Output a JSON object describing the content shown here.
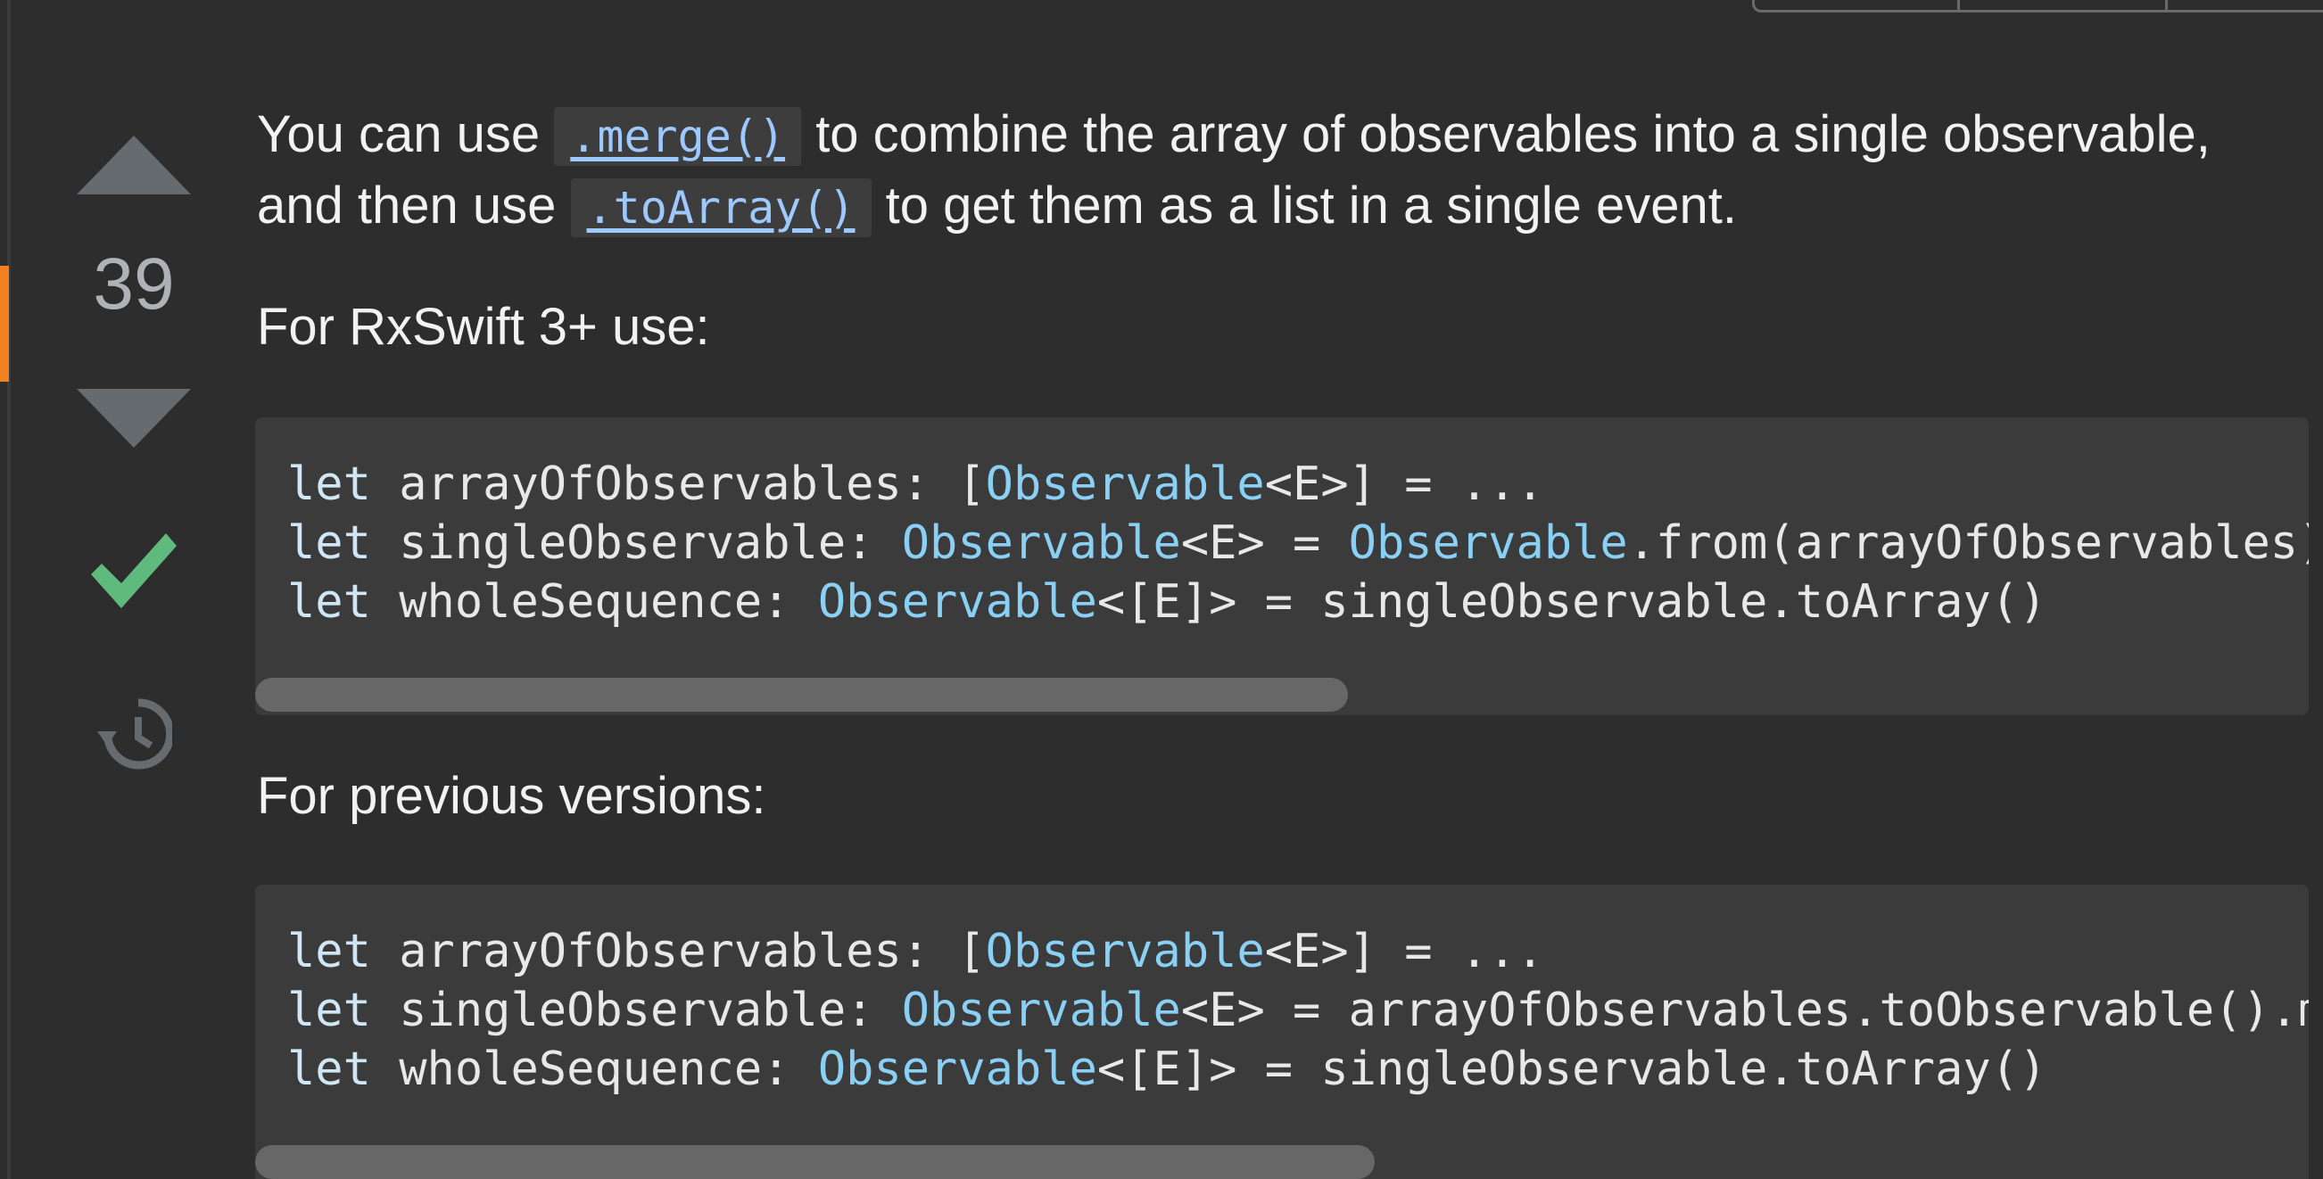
{
  "vote": {
    "count": "39",
    "upvote_icon": "triangle-up",
    "downvote_icon": "triangle-down",
    "accepted_icon": "checkmark",
    "history_icon": "history-clock",
    "accepted_color": "#5fba7d",
    "accent_color": "#f48024"
  },
  "answer": {
    "intro": {
      "t1": "You can use ",
      "code1": ".merge()",
      "t2": " to combine the array of observables into a single observable,",
      "t3": "and then use ",
      "code2": ".toArray()",
      "t4": " to get them as a list in a single event."
    },
    "heading_v3": "For RxSwift 3+ use:",
    "code_v3": [
      {
        "kw": "let",
        "name": " arrayOfObservables: [",
        "ty1": "Observable",
        "rest": "<E>] = ..."
      },
      {
        "kw": "let",
        "name": " singleObservable: ",
        "ty1": "Observable",
        "mid": "<E> = ",
        "ty2": "Observable",
        "rest": ".from(arrayOfObservables)"
      },
      {
        "kw": "let",
        "name": " wholeSequence: ",
        "ty1": "Observable",
        "rest": "<[E]> = singleObservable.toArray()"
      }
    ],
    "heading_prev": "For previous versions:",
    "code_prev": [
      {
        "kw": "let",
        "name": " arrayOfObservables: [",
        "ty1": "Observable",
        "rest": "<E>] = ..."
      },
      {
        "kw": "let",
        "name": " singleObservable: ",
        "ty1": "Observable",
        "rest": "<E> = arrayOfObservables.toObservable().m"
      },
      {
        "kw": "let",
        "name": " wholeSequence: ",
        "ty1": "Observable",
        "rest": "<[E]> = singleObservable.toArray()"
      }
    ],
    "scroll_v3_fraction": 0.532,
    "scroll_prev_fraction": 0.545
  }
}
